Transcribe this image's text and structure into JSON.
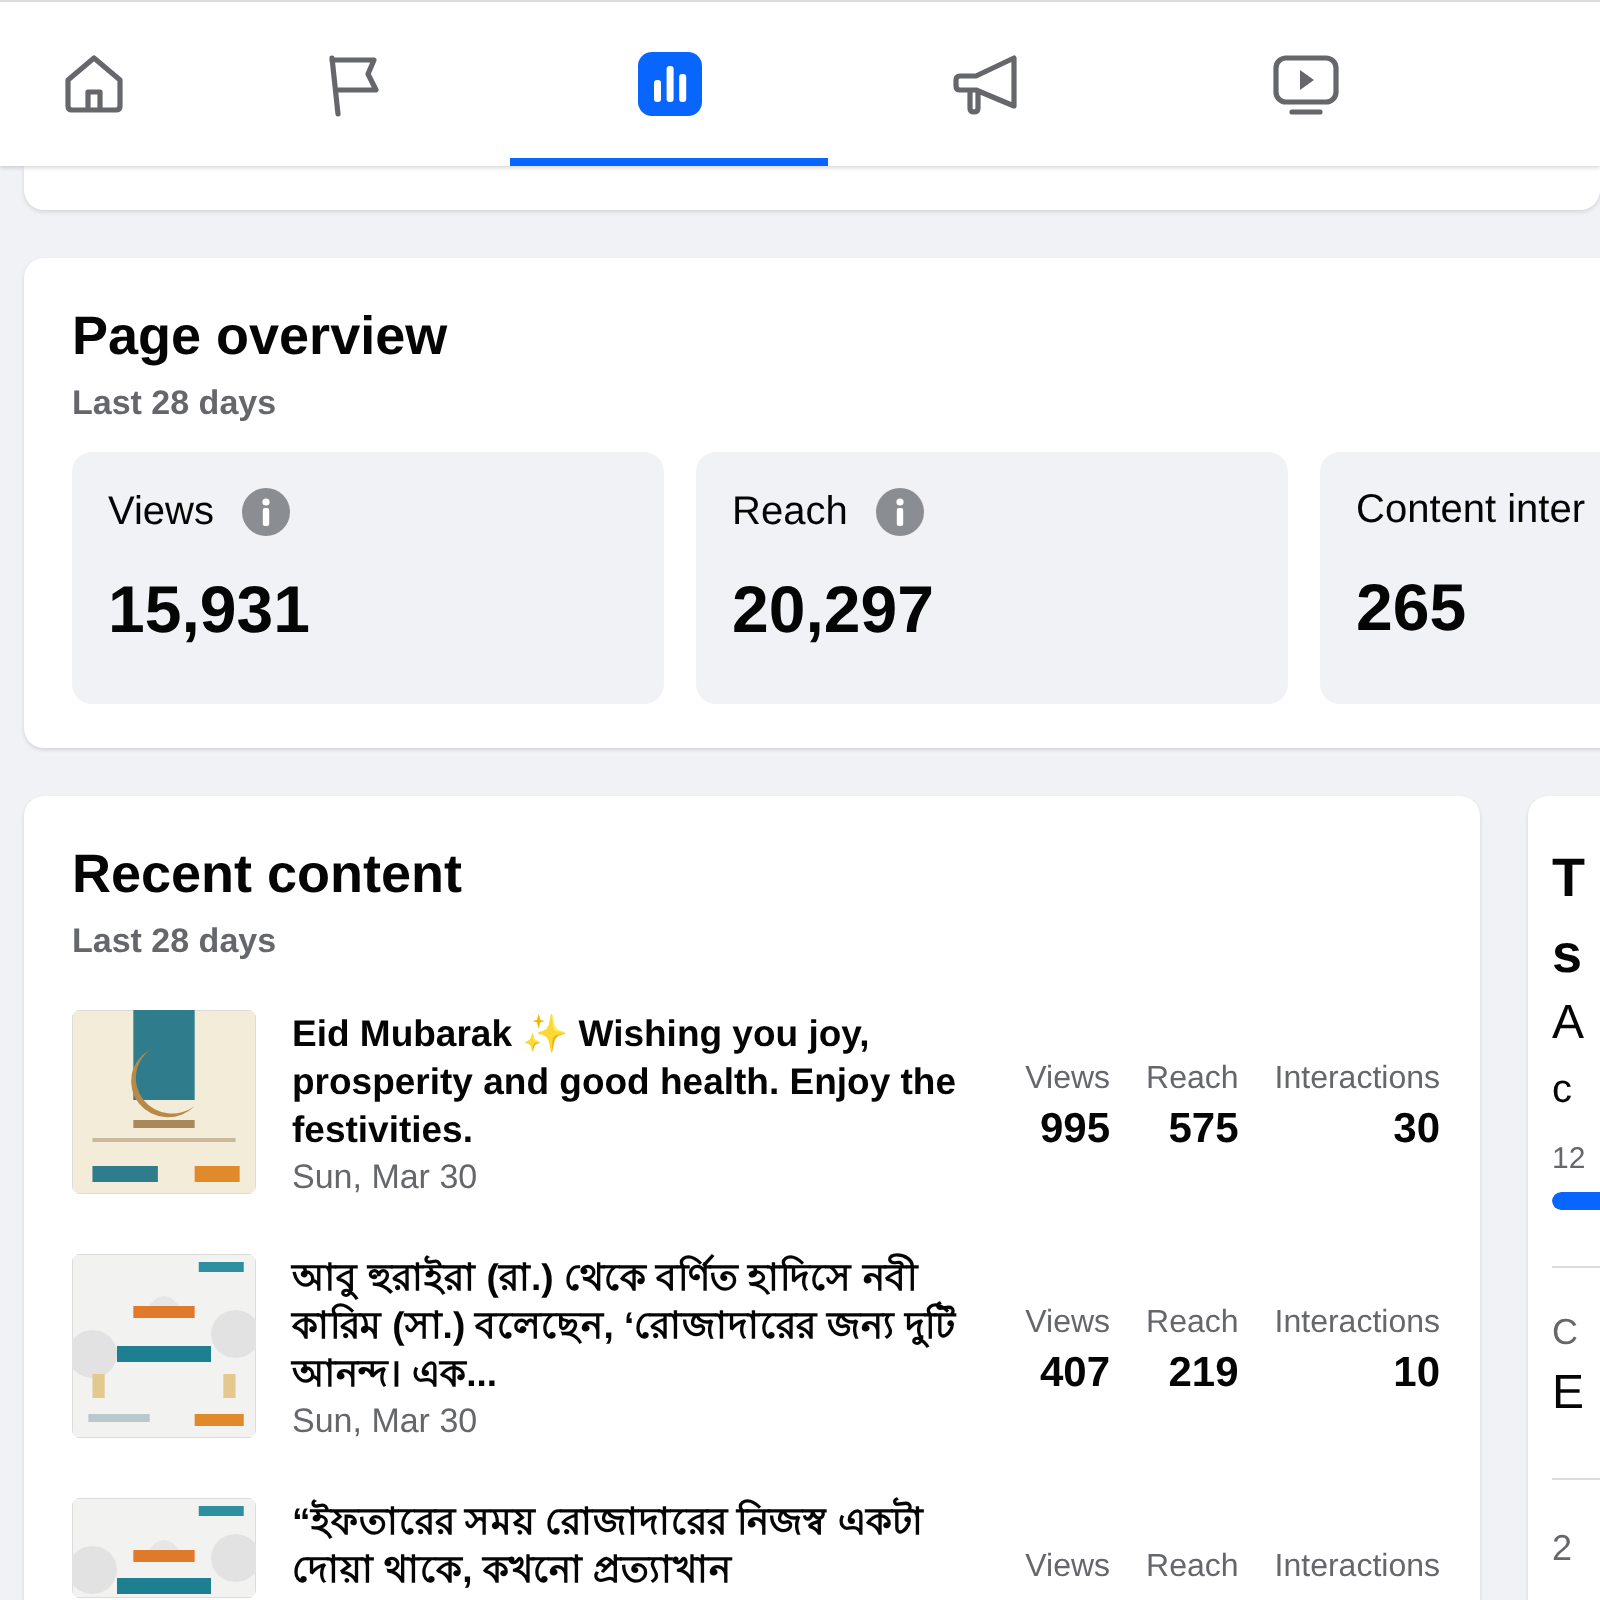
{
  "nav": {
    "tabs": [
      {
        "kind": "home",
        "selected": false
      },
      {
        "kind": "flag",
        "selected": false
      },
      {
        "kind": "insights",
        "selected": true
      },
      {
        "kind": "megaphone",
        "selected": false
      },
      {
        "kind": "video",
        "selected": false
      }
    ]
  },
  "overview": {
    "title": "Page overview",
    "subtitle": "Last 28 days",
    "metrics": [
      {
        "label": "Views",
        "info": true,
        "value": "15,931"
      },
      {
        "label": "Reach",
        "info": true,
        "value": "20,297"
      },
      {
        "label": "Content inter",
        "info": false,
        "value": "265"
      }
    ]
  },
  "recent": {
    "title": "Recent content",
    "subtitle": "Last 28 days",
    "posts": [
      {
        "text": "Eid Mubarak ✨ Wishing you joy, prosperity and good health. Enjoy the festivities.",
        "date": "Sun, Mar 30",
        "stats": [
          {
            "label": "Views",
            "value": "995"
          },
          {
            "label": "Reach",
            "value": "575"
          },
          {
            "label": "Interactions",
            "value": "30"
          }
        ]
      },
      {
        "text": "আবু হুরাইরা (রা.) থেকে বর্ণিত হাদিসে নবী কারিম (সা.) বলেছেন, ‘রোজাদারের জন্য দুটি আনন্দ। এক...",
        "date": "Sun, Mar 30",
        "stats": [
          {
            "label": "Views",
            "value": "407"
          },
          {
            "label": "Reach",
            "value": "219"
          },
          {
            "label": "Interactions",
            "value": "10"
          }
        ]
      },
      {
        "text": "“ইফতারের সময় রোজাদারের নিজস্ব একটা দোয়া থাকে, কখনো প্রত্যাখান",
        "stats": [
          {
            "label": "Views"
          },
          {
            "label": "Reach"
          },
          {
            "label": "Interactions"
          }
        ]
      }
    ]
  },
  "side": {
    "title_lines": [
      "T",
      "s"
    ],
    "line_1": "A",
    "line_2": "c",
    "count": "12",
    "level": 0.3,
    "label": "C",
    "value": "E",
    "footer": "2"
  }
}
